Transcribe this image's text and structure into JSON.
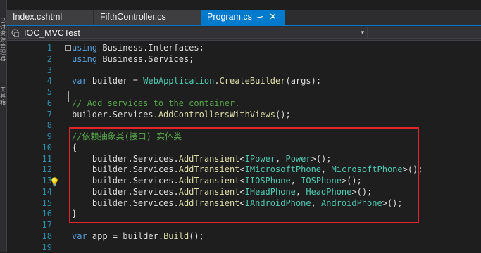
{
  "tabs": [
    {
      "label": "Index.cshtml",
      "active": false
    },
    {
      "label": "FifthController.cs",
      "active": false
    },
    {
      "label": "Program.cs",
      "active": true
    }
  ],
  "navigation": {
    "project_label": "IOC_MVCTest",
    "dropdown_arrow": "▾"
  },
  "left_strip_glyphs": [
    "已",
    "讨",
    "资",
    "源",
    "管",
    "理",
    "器",
    "工",
    "具",
    "箱"
  ],
  "colors": {
    "accent": "#007acc",
    "highlight_border": "#e0262b",
    "keyword": "#569cd6",
    "type": "#4ec9b0",
    "method": "#dcdcaa",
    "comment": "#57a64a",
    "line_number": "#2b91af"
  },
  "icons": {
    "pin": "pin-icon",
    "close": "close-icon",
    "lightbulb": "lightbulb-icon",
    "project": "project-icon"
  },
  "editor": {
    "lines": [
      {
        "n": "1",
        "tokens": [
          {
            "t": "using",
            "c": "k"
          },
          {
            "t": " Business.Interfaces;",
            "c": ""
          }
        ]
      },
      {
        "n": "2",
        "tokens": [
          {
            "t": "using",
            "c": "k"
          },
          {
            "t": " Business.Services;",
            "c": ""
          }
        ]
      },
      {
        "n": "3",
        "tokens": []
      },
      {
        "n": "4",
        "tokens": [
          {
            "t": "var",
            "c": "k"
          },
          {
            "t": " builder = ",
            "c": ""
          },
          {
            "t": "WebApplication",
            "c": "t"
          },
          {
            "t": ".",
            "c": ""
          },
          {
            "t": "CreateBuilder",
            "c": "m"
          },
          {
            "t": "(args);",
            "c": ""
          }
        ]
      },
      {
        "n": "5",
        "tokens": []
      },
      {
        "n": "6",
        "tokens": [
          {
            "t": "// Add services to the container.",
            "c": "c"
          }
        ]
      },
      {
        "n": "7",
        "tokens": [
          {
            "t": "builder.Services.",
            "c": ""
          },
          {
            "t": "AddControllersWithViews",
            "c": "m"
          },
          {
            "t": "();",
            "c": ""
          }
        ]
      },
      {
        "n": "8",
        "tokens": []
      },
      {
        "n": "9",
        "tokens": [
          {
            "t": "//依赖抽象类(接口) 实体类",
            "c": "c"
          }
        ]
      },
      {
        "n": "10",
        "tokens": [
          {
            "t": "{",
            "c": ""
          }
        ]
      },
      {
        "n": "11",
        "tokens": [
          {
            "t": "    builder.Services.",
            "c": ""
          },
          {
            "t": "AddTransient",
            "c": "m"
          },
          {
            "t": "<",
            "c": ""
          },
          {
            "t": "IPower",
            "c": "t"
          },
          {
            "t": ", ",
            "c": ""
          },
          {
            "t": "Power",
            "c": "t"
          },
          {
            "t": ">();",
            "c": ""
          }
        ]
      },
      {
        "n": "12",
        "tokens": [
          {
            "t": "    builder.Services.",
            "c": ""
          },
          {
            "t": "AddTransient",
            "c": "m"
          },
          {
            "t": "<",
            "c": ""
          },
          {
            "t": "IMicrosoftPhone",
            "c": "t"
          },
          {
            "t": ", ",
            "c": ""
          },
          {
            "t": "MicrosoftPhone",
            "c": "t"
          },
          {
            "t": ">();",
            "c": ""
          }
        ]
      },
      {
        "n": "13",
        "tokens": [
          {
            "t": "    builder.Services.",
            "c": ""
          },
          {
            "t": "AddTransient",
            "c": "m"
          },
          {
            "t": "<",
            "c": ""
          },
          {
            "t": "IIOSPhone",
            "c": "t"
          },
          {
            "t": ", ",
            "c": ""
          },
          {
            "t": "IOSPhone",
            "c": "t"
          },
          {
            "t": ">();",
            "c": ""
          }
        ]
      },
      {
        "n": "14",
        "tokens": [
          {
            "t": "    builder.Services.",
            "c": ""
          },
          {
            "t": "AddTransient",
            "c": "m"
          },
          {
            "t": "<",
            "c": ""
          },
          {
            "t": "IHeadPhone",
            "c": "t"
          },
          {
            "t": ", ",
            "c": ""
          },
          {
            "t": "HeadPhone",
            "c": "t"
          },
          {
            "t": ">();",
            "c": ""
          }
        ]
      },
      {
        "n": "15",
        "tokens": [
          {
            "t": "    builder.Services.",
            "c": ""
          },
          {
            "t": "AddTransient",
            "c": "m"
          },
          {
            "t": "<",
            "c": ""
          },
          {
            "t": "IAndroidPhone",
            "c": "t"
          },
          {
            "t": ", ",
            "c": ""
          },
          {
            "t": "AndroidPhone",
            "c": "t"
          },
          {
            "t": ">();",
            "c": ""
          }
        ]
      },
      {
        "n": "16",
        "tokens": [
          {
            "t": "}",
            "c": ""
          }
        ]
      },
      {
        "n": "17",
        "tokens": []
      },
      {
        "n": "18",
        "tokens": [
          {
            "t": "var",
            "c": "k"
          },
          {
            "t": " app = builder.",
            "c": ""
          },
          {
            "t": "Build",
            "c": "m"
          },
          {
            "t": "();",
            "c": ""
          }
        ]
      },
      {
        "n": "19",
        "tokens": []
      }
    ]
  }
}
